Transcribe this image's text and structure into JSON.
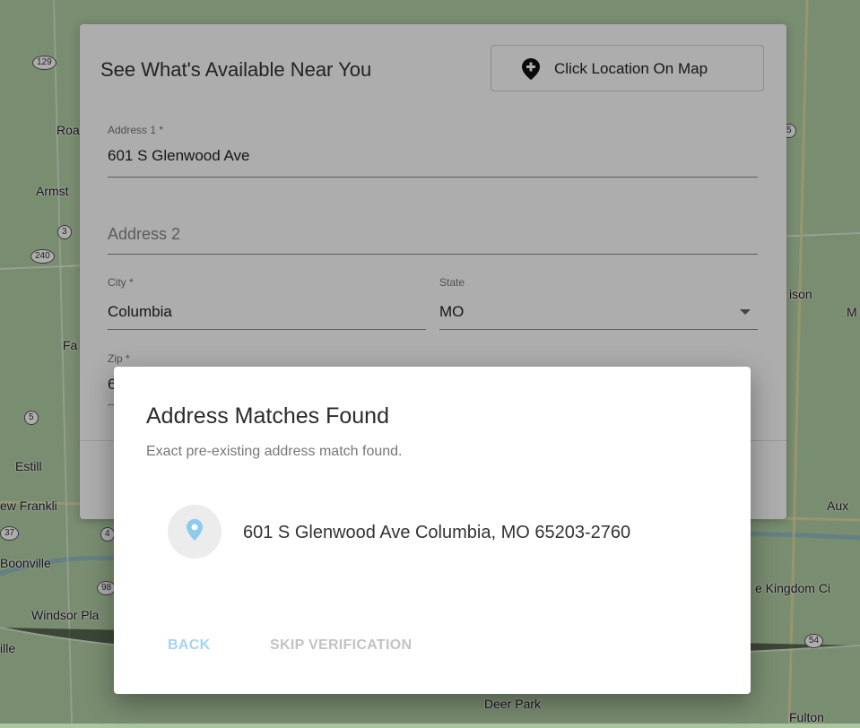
{
  "map": {
    "labels": [
      "Roa",
      "Armst",
      "Fa",
      "Estill",
      "ew Frankli",
      "Boonville",
      "Windsor Pla",
      "ille",
      "Deer Park",
      "ison",
      "M",
      "Aux",
      "e Kingdom Ci",
      "Fulton"
    ],
    "shields": [
      "129",
      "3",
      "240",
      "5",
      "37",
      "4",
      "98",
      "54",
      "5"
    ]
  },
  "form": {
    "title": "See What's Available Near You",
    "map_button_label": "Click Location On Map",
    "address1": {
      "label": "Address 1 *",
      "value": "601 S Glenwood Ave"
    },
    "address2": {
      "placeholder": "Address 2"
    },
    "city": {
      "label": "City *",
      "value": "Columbia"
    },
    "state": {
      "label": "State",
      "value": "MO"
    },
    "zip": {
      "label": "Zip *",
      "value": "6"
    }
  },
  "dialog": {
    "title": "Address Matches Found",
    "subtitle": "Exact pre-existing address match found.",
    "match_address": "601 S Glenwood Ave Columbia, MO 65203-2760",
    "back_label": "BACK",
    "skip_label": "SKIP VERIFICATION"
  },
  "colors": {
    "accent_light": "#a6d3ef",
    "pin_blue": "#8ccbee",
    "disabled_text": "#c3c3c3"
  }
}
